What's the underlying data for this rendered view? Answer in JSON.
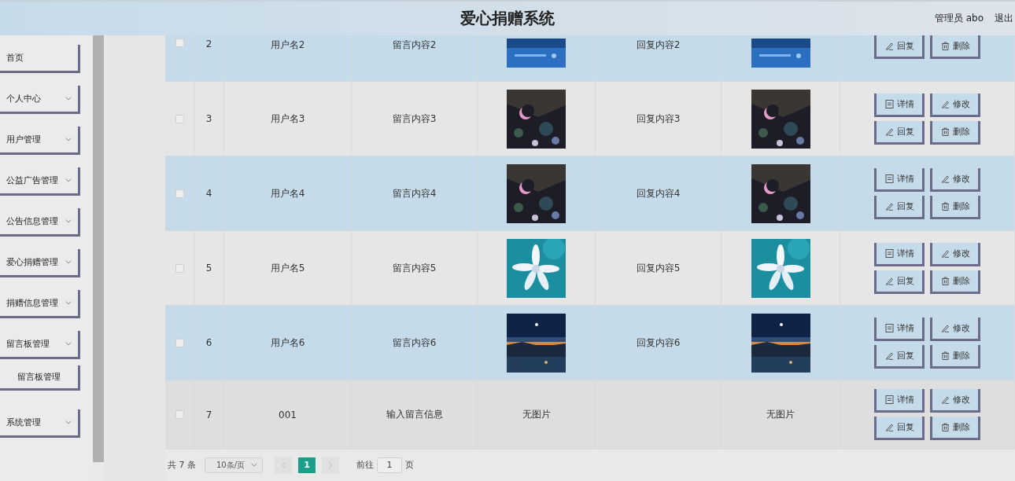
{
  "header": {
    "title": "爱心捐赠系统",
    "user": "管理员 abo",
    "logout": "退出"
  },
  "sidebar": {
    "items": [
      {
        "label": "首页",
        "kind": "link"
      },
      {
        "label": "个人中心",
        "kind": "submenu"
      },
      {
        "label": "用户管理",
        "kind": "submenu"
      },
      {
        "label": "公益广告管理",
        "kind": "submenu"
      },
      {
        "label": "公告信息管理",
        "kind": "submenu"
      },
      {
        "label": "爱心捐赠管理",
        "kind": "submenu"
      },
      {
        "label": "捐赠信息管理",
        "kind": "submenu"
      },
      {
        "label": "留言板管理",
        "kind": "submenu",
        "children": [
          {
            "label": "留言板管理"
          }
        ]
      },
      {
        "label": "系统管理",
        "kind": "submenu"
      }
    ]
  },
  "table": {
    "rows": [
      {
        "checked": false,
        "hovered": false,
        "cut_off_top": true,
        "index": "2",
        "username": "用户名2",
        "message": "留言内容2",
        "image": {
          "kind": "picture"
        },
        "reply": "回复内容2",
        "reply_image": {
          "kind": "picture"
        },
        "actions": [
          {
            "label": "回复",
            "kind": "reply"
          },
          {
            "label": "删除",
            "kind": "delete"
          }
        ]
      },
      {
        "checked": false,
        "hovered": false,
        "cut_off_top": false,
        "index": "3",
        "username": "用户名3",
        "message": "留言内容3",
        "image": {
          "kind": "picture"
        },
        "reply": "回复内容3",
        "reply_image": {
          "kind": "picture"
        },
        "actions": [
          {
            "label": "详情",
            "kind": "detail"
          },
          {
            "label": "修改",
            "kind": "edit"
          },
          {
            "label": "回复",
            "kind": "reply"
          },
          {
            "label": "删除",
            "kind": "delete"
          }
        ]
      },
      {
        "checked": false,
        "hovered": false,
        "cut_off_top": false,
        "index": "4",
        "username": "用户名4",
        "message": "留言内容4",
        "image": {
          "kind": "picture"
        },
        "reply": "回复内容4",
        "reply_image": {
          "kind": "picture"
        },
        "actions": [
          {
            "label": "详情",
            "kind": "detail"
          },
          {
            "label": "修改",
            "kind": "edit"
          },
          {
            "label": "回复",
            "kind": "reply"
          },
          {
            "label": "删除",
            "kind": "delete"
          }
        ]
      },
      {
        "checked": false,
        "hovered": false,
        "cut_off_top": false,
        "index": "5",
        "username": "用户名5",
        "message": "留言内容5",
        "image": {
          "kind": "picture"
        },
        "reply": "回复内容5",
        "reply_image": {
          "kind": "picture"
        },
        "actions": [
          {
            "label": "详情",
            "kind": "detail"
          },
          {
            "label": "修改",
            "kind": "edit"
          },
          {
            "label": "回复",
            "kind": "reply"
          },
          {
            "label": "删除",
            "kind": "delete"
          }
        ]
      },
      {
        "checked": false,
        "hovered": false,
        "cut_off_top": false,
        "index": "6",
        "username": "用户名6",
        "message": "留言内容6",
        "image": {
          "kind": "picture"
        },
        "reply": "回复内容6",
        "reply_image": {
          "kind": "picture"
        },
        "actions": [
          {
            "label": "详情",
            "kind": "detail"
          },
          {
            "label": "修改",
            "kind": "edit"
          },
          {
            "label": "回复",
            "kind": "reply"
          },
          {
            "label": "删除",
            "kind": "delete"
          }
        ]
      },
      {
        "checked": false,
        "hovered": true,
        "cut_off_top": false,
        "index": "7",
        "username": "001",
        "message": "输入留言信息",
        "image": {
          "kind": "text",
          "text": "无图片"
        },
        "reply_image": {
          "kind": "text",
          "text": "无图片"
        },
        "actions": [
          {
            "label": "详情",
            "kind": "detail"
          },
          {
            "label": "修改",
            "kind": "edit"
          },
          {
            "label": "回复",
            "kind": "reply"
          },
          {
            "label": "删除",
            "kind": "delete"
          }
        ]
      }
    ]
  },
  "pagination": {
    "total": "共 7 条",
    "page_size": "10条/页",
    "pages": [
      {
        "label": "1",
        "selected": true
      }
    ],
    "goto_label": "前往",
    "goto_value": "1",
    "goto_suffix": "页"
  }
}
